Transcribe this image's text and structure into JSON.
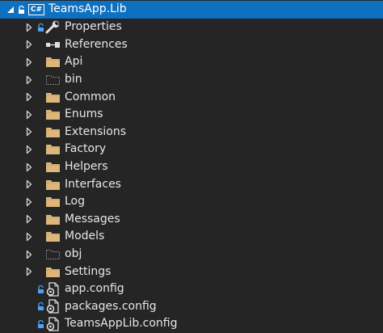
{
  "root": {
    "label": "TeamsApp.Lib",
    "project_badge": "C#"
  },
  "items": [
    {
      "label": "Properties",
      "icon": "wrench-icon",
      "expandable": true,
      "locked": true
    },
    {
      "label": "References",
      "icon": "references-icon",
      "expandable": true,
      "locked": false
    },
    {
      "label": "Api",
      "icon": "folder-icon",
      "expandable": true,
      "locked": false
    },
    {
      "label": "bin",
      "icon": "hidden-folder-icon",
      "expandable": true,
      "locked": false
    },
    {
      "label": "Common",
      "icon": "folder-icon",
      "expandable": true,
      "locked": false
    },
    {
      "label": "Enums",
      "icon": "folder-icon",
      "expandable": true,
      "locked": false
    },
    {
      "label": "Extensions",
      "icon": "folder-icon",
      "expandable": true,
      "locked": false
    },
    {
      "label": "Factory",
      "icon": "folder-icon",
      "expandable": true,
      "locked": false
    },
    {
      "label": "Helpers",
      "icon": "folder-icon",
      "expandable": true,
      "locked": false
    },
    {
      "label": "Interfaces",
      "icon": "folder-icon",
      "expandable": true,
      "locked": false
    },
    {
      "label": "Log",
      "icon": "folder-icon",
      "expandable": true,
      "locked": false
    },
    {
      "label": "Messages",
      "icon": "folder-icon",
      "expandable": true,
      "locked": false
    },
    {
      "label": "Models",
      "icon": "folder-icon",
      "expandable": true,
      "locked": false
    },
    {
      "label": "obj",
      "icon": "hidden-folder-icon",
      "expandable": true,
      "locked": false
    },
    {
      "label": "Settings",
      "icon": "folder-icon",
      "expandable": true,
      "locked": false
    },
    {
      "label": "app.config",
      "icon": "config-file-icon",
      "expandable": false,
      "locked": true
    },
    {
      "label": "packages.config",
      "icon": "config-file-icon",
      "expandable": false,
      "locked": true
    },
    {
      "label": "TeamsAppLib.config",
      "icon": "config-file-icon",
      "expandable": false,
      "locked": true
    }
  ],
  "colors": {
    "background": "#252526",
    "selection": "#0e70c0",
    "folder": "#dcb67a",
    "text": "#e6e6e6"
  }
}
